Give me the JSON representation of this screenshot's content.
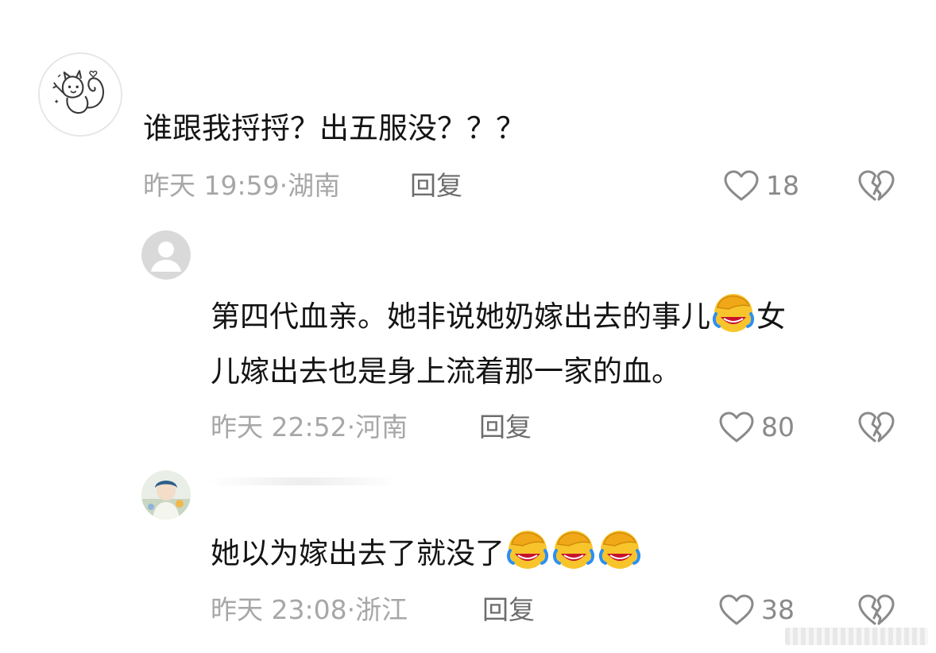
{
  "comments": [
    {
      "text": "谁跟我捋捋？出五服没？？？",
      "time": "昨天 19:59",
      "location": "湖南",
      "reply_label": "回复",
      "likes": "18",
      "avatar_icon": "squirrel-cartoon-avatar-icon"
    },
    {
      "text_line1_part1": "第四代血亲。她非说她奶嫁出去的事儿",
      "text_line1_part2": "女",
      "text_line2": "儿嫁出去也是身上流着那一家的血。",
      "time": "昨天 22:52",
      "location": "河南",
      "reply_label": "回复",
      "likes": "80",
      "avatar_icon": "default-user-avatar-icon",
      "emoji": "face-palm-laughing-emoji"
    },
    {
      "text": "她以为嫁出去了就没了",
      "time": "昨天 23:08",
      "location": "浙江",
      "reply_label": "回复",
      "likes": "38",
      "avatar_icon": "photo-avatar-icon",
      "emojis": [
        "face-palm-laughing-emoji",
        "face-palm-laughing-emoji",
        "face-palm-laughing-emoji"
      ]
    }
  ],
  "separator": "·",
  "colors": {
    "text": "#141414",
    "meta": "#a7a7a7",
    "reply": "#6d6d6d",
    "icon": "#8a8a8a",
    "emoji_yellow": "#f7c52b"
  }
}
